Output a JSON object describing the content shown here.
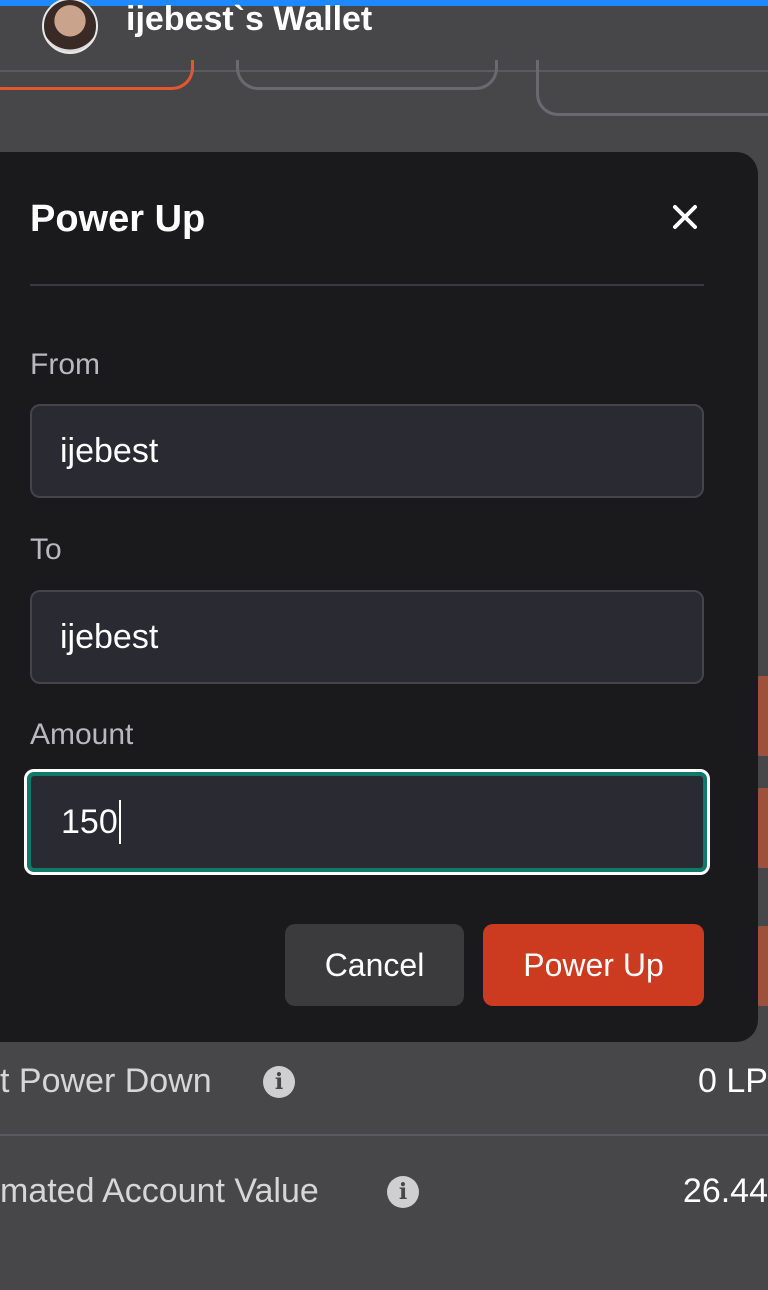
{
  "header": {
    "wallet_title": "ijebest`s Wallet"
  },
  "modal": {
    "title": "Power Up",
    "fields": {
      "from": {
        "label": "From",
        "value": "ijebest"
      },
      "to": {
        "label": "To",
        "value": "ijebest"
      },
      "amount": {
        "label": "Amount",
        "value": "150"
      }
    },
    "buttons": {
      "cancel": "Cancel",
      "submit": "Power Up"
    }
  },
  "rows": [
    {
      "label": "t Power Down",
      "value": "0 LP"
    },
    {
      "label": "mated Account Value",
      "value": "26.44"
    }
  ],
  "icons": {
    "close": "close-icon",
    "info": "info-icon",
    "avatar": "avatar"
  },
  "colors": {
    "accent": "#cc3a1f",
    "focus_ring": "#0f7a6a",
    "modal_bg": "#1a1a1c",
    "page_bg": "#474749",
    "top_bar": "#1e88ff"
  }
}
